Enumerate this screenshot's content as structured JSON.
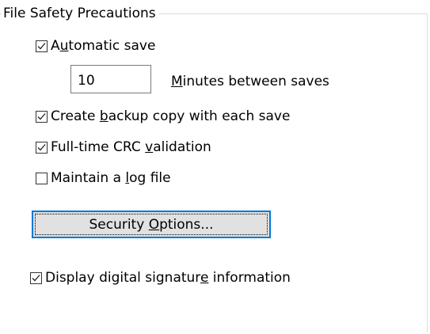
{
  "group": {
    "title": "File Safety Precautions"
  },
  "autosave": {
    "checked": true,
    "pre": "A",
    "key": "u",
    "post": "tomatic save"
  },
  "minutes": {
    "value": "10",
    "label_key": "M",
    "label_post": "inutes between saves"
  },
  "backup": {
    "checked": true,
    "pre": "Create ",
    "key": "b",
    "post": "ackup copy with each save"
  },
  "crc": {
    "checked": true,
    "pre": "Full-time CRC ",
    "key": "v",
    "post": "alidation"
  },
  "logfile": {
    "checked": false,
    "pre": "Maintain a ",
    "key": "l",
    "post": "og file"
  },
  "security_button": {
    "pre": "Security ",
    "key": "O",
    "post": "ptions..."
  },
  "signature": {
    "checked": true,
    "pre": "Display digital signatur",
    "key": "e",
    "post": " information"
  },
  "colors": {
    "focus_border": "#0078d7",
    "button_face": "#e1e1e1",
    "group_border": "#dcdcdc"
  }
}
